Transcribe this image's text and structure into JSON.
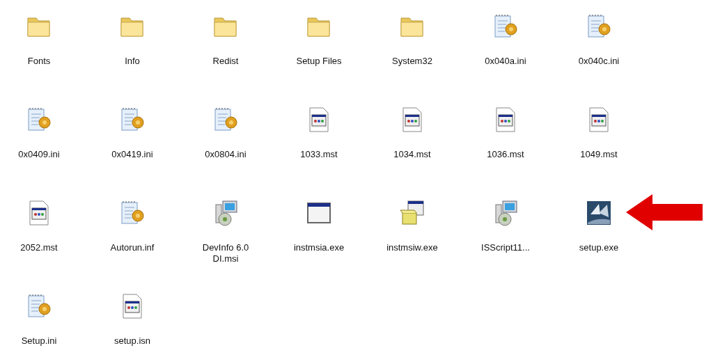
{
  "files": [
    {
      "name": "Fonts",
      "kind": "folder"
    },
    {
      "name": "Info",
      "kind": "folder"
    },
    {
      "name": "Redist",
      "kind": "folder"
    },
    {
      "name": "Setup Files",
      "kind": "folder"
    },
    {
      "name": "System32",
      "kind": "folder"
    },
    {
      "name": "0x040a.ini",
      "kind": "ini"
    },
    {
      "name": "0x040c.ini",
      "kind": "ini"
    },
    {
      "name": "0x0409.ini",
      "kind": "ini"
    },
    {
      "name": "0x0419.ini",
      "kind": "ini"
    },
    {
      "name": "0x0804.ini",
      "kind": "ini"
    },
    {
      "name": "1033.mst",
      "kind": "mst"
    },
    {
      "name": "1034.mst",
      "kind": "mst"
    },
    {
      "name": "1036.mst",
      "kind": "mst"
    },
    {
      "name": "1049.mst",
      "kind": "mst"
    },
    {
      "name": "2052.mst",
      "kind": "mst"
    },
    {
      "name": "Autorun.inf",
      "kind": "ini"
    },
    {
      "name": "DevInfo 6.0 DI.msi",
      "kind": "msi"
    },
    {
      "name": "instmsia.exe",
      "kind": "window"
    },
    {
      "name": "instmsiw.exe",
      "kind": "package"
    },
    {
      "name": "ISScript11...",
      "kind": "msi"
    },
    {
      "name": "setup.exe",
      "kind": "setup"
    },
    {
      "name": "Setup.ini",
      "kind": "ini"
    },
    {
      "name": "setup.isn",
      "kind": "mst"
    }
  ]
}
